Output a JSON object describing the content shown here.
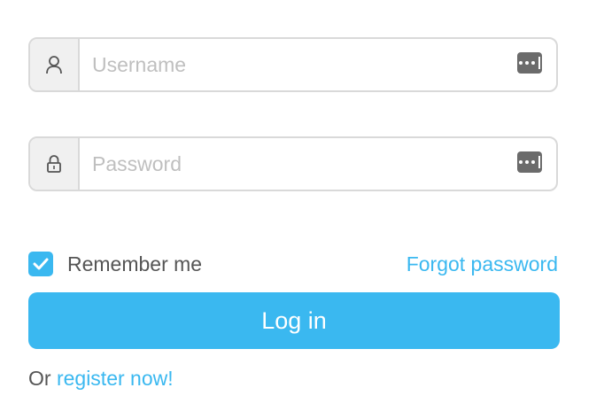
{
  "username": {
    "icon": "user-icon",
    "placeholder": "Username",
    "value": "",
    "autofill_icon": "password-manager-icon"
  },
  "password": {
    "icon": "lock-icon",
    "placeholder": "Password",
    "value": "",
    "autofill_icon": "password-manager-icon"
  },
  "remember": {
    "label": "Remember me",
    "checked": true,
    "check_icon": "checkmark-icon"
  },
  "forgot_link": "Forgot password",
  "login_button": "Log in",
  "register": {
    "prefix": "Or ",
    "link": "register now!"
  },
  "colors": {
    "accent": "#3ab8f0",
    "border": "#d9d9d9",
    "addon_bg": "#f0f0f0",
    "placeholder": "#bfbfbf",
    "text": "#555555"
  }
}
